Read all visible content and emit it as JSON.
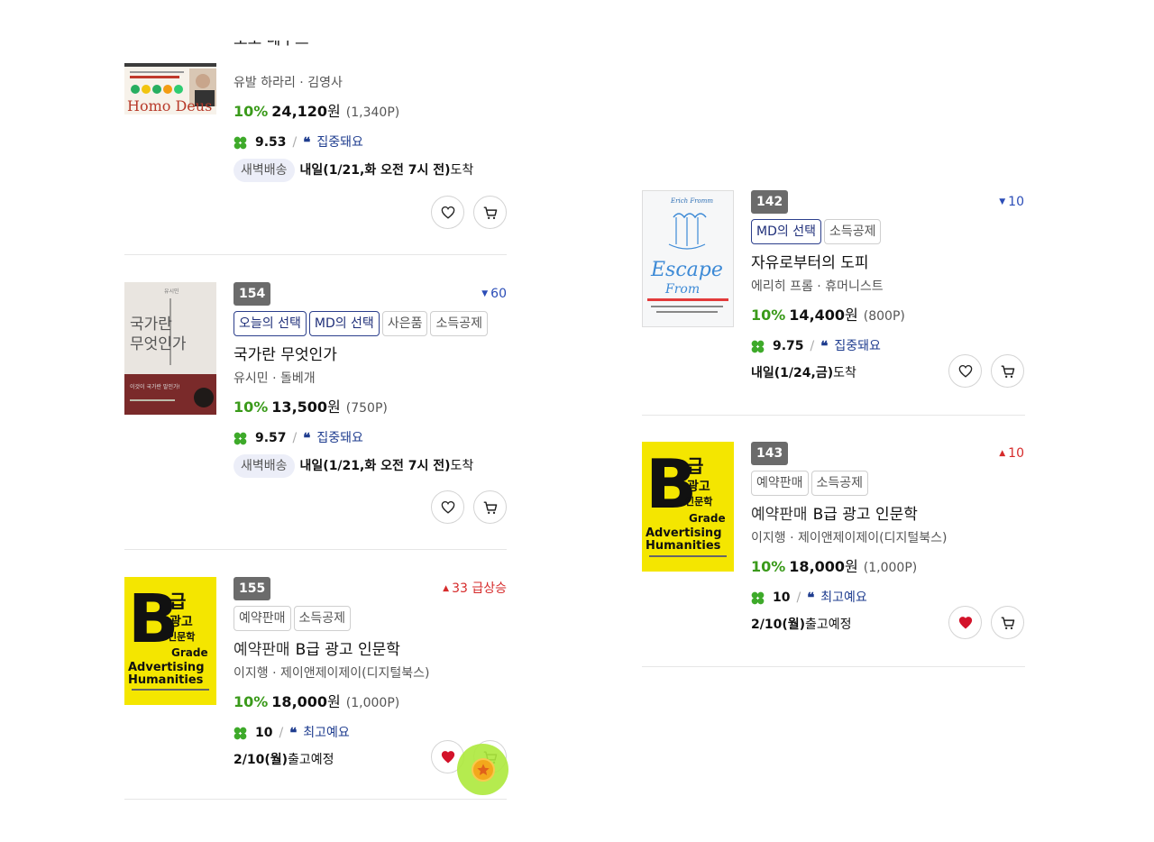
{
  "items": [
    {
      "id": "homo-deus",
      "title": "호모 데우스",
      "author": "유발 하라리 · 김영사",
      "discount": "10%",
      "price": "24,120",
      "won": "원",
      "point": "(1,340P)",
      "score": "9.53",
      "review": "집중돼요",
      "delivery_badge": "새벽배송",
      "delivery_strong": "내일(1/21,화 오전 7시 전)",
      "delivery_rest": " 도착",
      "liked": false,
      "cover_text": "Homo Deus"
    },
    {
      "id": "what-is-state",
      "rank": "154",
      "change": "60",
      "change_dir": "down",
      "tags": [
        "오늘의 선택",
        "MD의 선택",
        "사은품",
        "소득공제"
      ],
      "title": "국가란 무엇인가",
      "author": "유시민 · 돌베개",
      "discount": "10%",
      "price": "13,500",
      "won": "원",
      "point": "(750P)",
      "score": "9.57",
      "review": "집중돼요",
      "delivery_badge": "새벽배송",
      "delivery_strong": "내일(1/21,화 오전 7시 전)",
      "delivery_rest": " 도착",
      "liked": false,
      "cover_text": "국가란 무엇인가"
    },
    {
      "id": "b-grade-left",
      "rank": "155",
      "change": "33 급상승",
      "change_dir": "up",
      "tags": [
        "예약판매",
        "소득공제"
      ],
      "title_prefix": "예약판매",
      "title": "B급 광고 인문학",
      "author": "이지행 · 제이앤제이제이(디지털북스)",
      "discount": "10%",
      "price": "18,000",
      "won": "원",
      "point": "(1,000P)",
      "score": "10",
      "review": "최고예요",
      "delivery_strong": "2/10(월)",
      "delivery_rest": " 출고예정",
      "liked": true,
      "cover_text": "B급 광고 인문학"
    },
    {
      "id": "escape-from-freedom",
      "rank": "142",
      "change": "10",
      "change_dir": "down",
      "tags": [
        "MD의 선택",
        "소득공제"
      ],
      "title": "자유로부터의 도피",
      "author": "에리히 프롬 · 휴머니스트",
      "discount": "10%",
      "price": "14,400",
      "won": "원",
      "point": "(800P)",
      "score": "9.75",
      "review": "집중돼요",
      "delivery_strong": "내일(1/24,금)",
      "delivery_rest": " 도착",
      "liked": false,
      "cover_text": "Escape from Freedom"
    },
    {
      "id": "b-grade-right",
      "rank": "143",
      "change": "10",
      "change_dir": "up",
      "tags": [
        "예약판매",
        "소득공제"
      ],
      "title_prefix": "예약판매",
      "title": "B급 광고 인문학",
      "author": "이지행 · 제이앤제이제이(디지털북스)",
      "discount": "10%",
      "price": "18,000",
      "won": "원",
      "point": "(1,000P)",
      "score": "10",
      "review": "최고예요",
      "delivery_strong": "2/10(월)",
      "delivery_rest": " 출고예정",
      "liked": true,
      "cover_text": "B급 광고 인문학"
    }
  ],
  "colors": {
    "discount": "#3a9a1a",
    "rank_badge": "#6b6b6b",
    "rank_down": "#2b4db7",
    "rank_up": "#d62b2b",
    "review": "#1f3d8f",
    "tag_blue": "#2c3f8c",
    "heart_active": "#d3132a",
    "fab": "#ade93c",
    "b_grade_cover": "#f4e600"
  },
  "icons": {
    "like": "heart-icon",
    "cart": "cart-icon",
    "rating": "clover-icon",
    "review": "quote-icon",
    "fab": "coin-star-icon"
  }
}
